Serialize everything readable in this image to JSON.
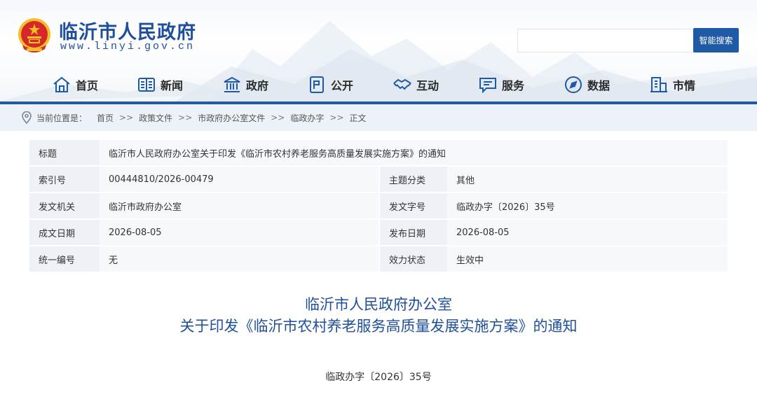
{
  "header": {
    "site_title": "临沂市人民政府",
    "site_url": "www.linyi.gov.cn",
    "search_placeholder": "",
    "search_button": "智能搜索"
  },
  "nav": [
    {
      "label": "首页",
      "icon": "home-icon"
    },
    {
      "label": "新闻",
      "icon": "newspaper-icon"
    },
    {
      "label": "政府",
      "icon": "government-building-icon"
    },
    {
      "label": "公开",
      "icon": "disclosure-icon"
    },
    {
      "label": "互动",
      "icon": "handshake-icon"
    },
    {
      "label": "服务",
      "icon": "service-chat-icon"
    },
    {
      "label": "数据",
      "icon": "data-compass-icon"
    },
    {
      "label": "市情",
      "icon": "city-building-icon"
    }
  ],
  "breadcrumb": {
    "label": "当前位置是：",
    "separator": ">>",
    "items": [
      "首页",
      "政策文件",
      "市政府办公室文件",
      "临政办字",
      "正文"
    ]
  },
  "info": {
    "title_key": "标题",
    "title_value": "临沂市人民政府办公室关于印发《临沂市农村养老服务高质量发展实施方案》的通知",
    "index_key": "索引号",
    "index_value": "00444810/2026-00479",
    "topic_key": "主题分类",
    "topic_value": "其他",
    "issuer_key": "发文机关",
    "issuer_value": "临沂市政府办公室",
    "docno_key": "发文字号",
    "docno_value": "临政办字〔2026〕35号",
    "created_key": "成文日期",
    "created_value": "2026-08-05",
    "published_key": "发布日期",
    "published_value": "2026-08-05",
    "code_key": "统一编号",
    "code_value": "无",
    "status_key": "效力状态",
    "status_value": "生效中"
  },
  "document": {
    "title_line1": "临沂市人民政府办公室",
    "title_line2": "关于印发《临沂市农村养老服务高质量发展实施方案》的通知",
    "number": "临政办字〔2026〕35号"
  },
  "colors": {
    "brand_blue": "#1f4f9c",
    "nav_bar": "#1f5aa6",
    "emblem_red": "#d62828",
    "emblem_gold": "#f2c029"
  }
}
